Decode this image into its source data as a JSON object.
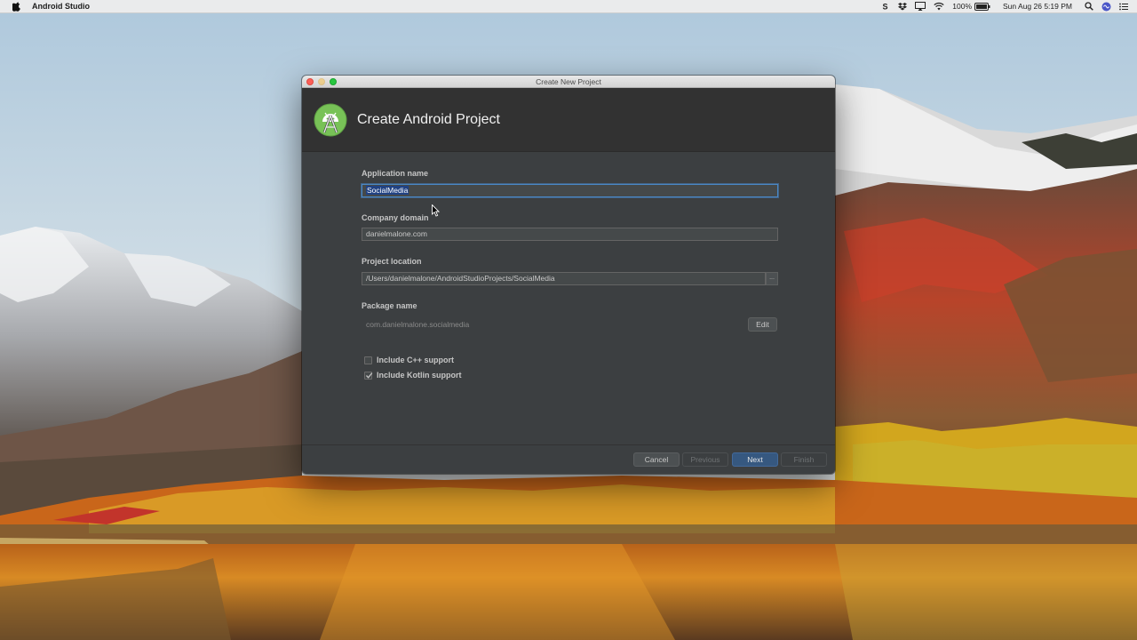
{
  "menubar": {
    "app_name": "Android Studio",
    "battery": "100%",
    "datetime": "Sun Aug 26  5:19 PM",
    "icons": [
      "apple-icon",
      "skype-icon",
      "dropbox-icon",
      "airplay-icon",
      "wifi-icon",
      "battery-icon",
      "search-icon",
      "siri-icon",
      "menu-list-icon"
    ]
  },
  "dialog": {
    "window_title": "Create New Project",
    "header_title": "Create Android Project",
    "logo": "android-studio-icon",
    "fields": {
      "app_name_label": "Application name",
      "app_name_value": "SocialMedia",
      "company_domain_label": "Company domain",
      "company_domain_value": "danielmalone.com",
      "project_location_label": "Project location",
      "project_location_value": "/Users/danielmalone/AndroidStudioProjects/SocialMedia",
      "browse_label": "...",
      "package_name_label": "Package name",
      "package_name_value": "com.danielmalone.socialmedia",
      "edit_label": "Edit"
    },
    "checkboxes": {
      "cpp_label": "Include C++ support",
      "cpp_checked": false,
      "kotlin_label": "Include Kotlin support",
      "kotlin_checked": true
    },
    "buttons": {
      "cancel": "Cancel",
      "previous": "Previous",
      "next": "Next",
      "finish": "Finish"
    }
  },
  "colors": {
    "dialog_bg": "#3c3f41",
    "header_bg": "#323232",
    "accent_blue": "#365880",
    "android_green": "#78c257"
  }
}
